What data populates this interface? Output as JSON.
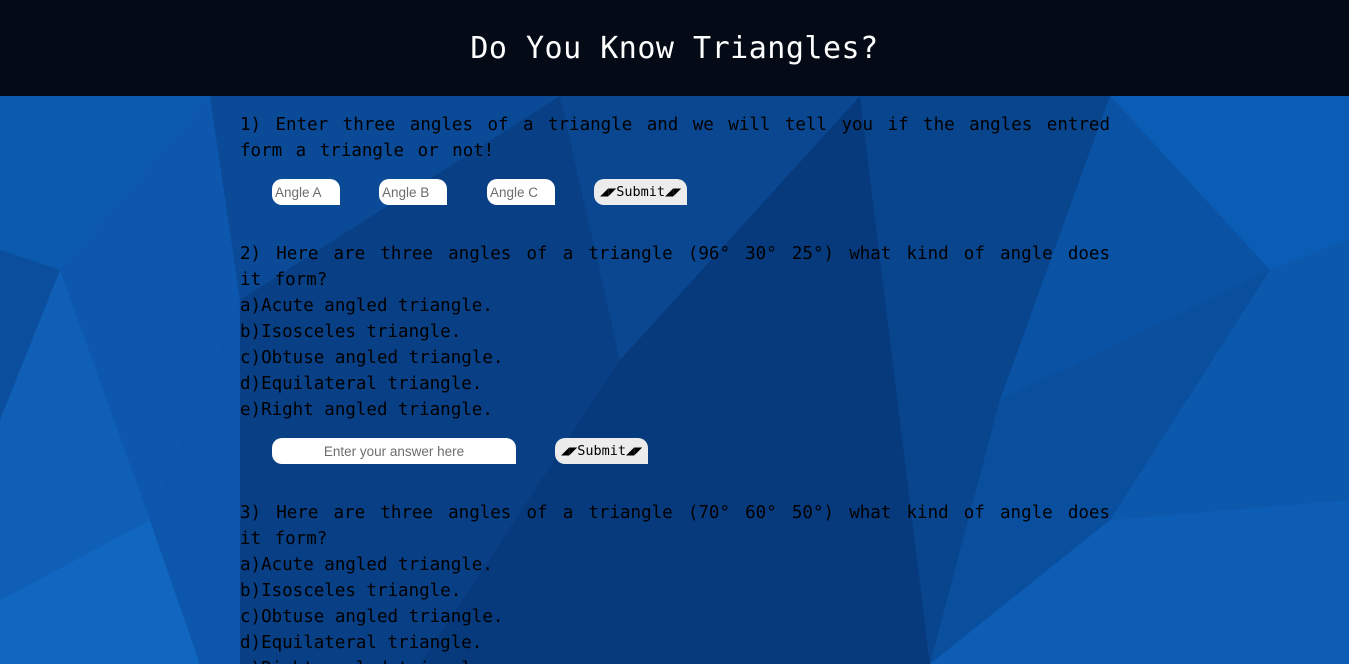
{
  "header": {
    "title": "Do You Know Triangles?"
  },
  "colors": {
    "header_bg": "#040b16",
    "page_bg": "#0a4d9c",
    "text": "#000000"
  },
  "q1": {
    "text": "1) Enter three angles of a triangle and we will tell you if the angles entred form a triangle or not!",
    "angle_a_placeholder": "Angle A",
    "angle_b_placeholder": "Angle B",
    "angle_c_placeholder": "Angle C",
    "submit_label": "◢◤Submit◢◤"
  },
  "q2": {
    "text": "2) Here are three angles of a triangle (96° 30° 25°) what kind of angle does it form?",
    "options": [
      "a)Acute angled triangle.",
      "b)Isosceles triangle.",
      "c)Obtuse angled triangle.",
      "d)Equilateral triangle.",
      "e)Right angled triangle."
    ],
    "answer_placeholder": "Enter your answer here",
    "submit_label": "◢◤Submit◢◤"
  },
  "q3": {
    "text": "3) Here are three angles of a triangle (70° 60° 50°) what kind of angle does it form?",
    "options": [
      "a)Acute angled triangle.",
      "b)Isosceles triangle.",
      "c)Obtuse angled triangle.",
      "d)Equilateral triangle.",
      "e)Right angled triangle."
    ]
  }
}
